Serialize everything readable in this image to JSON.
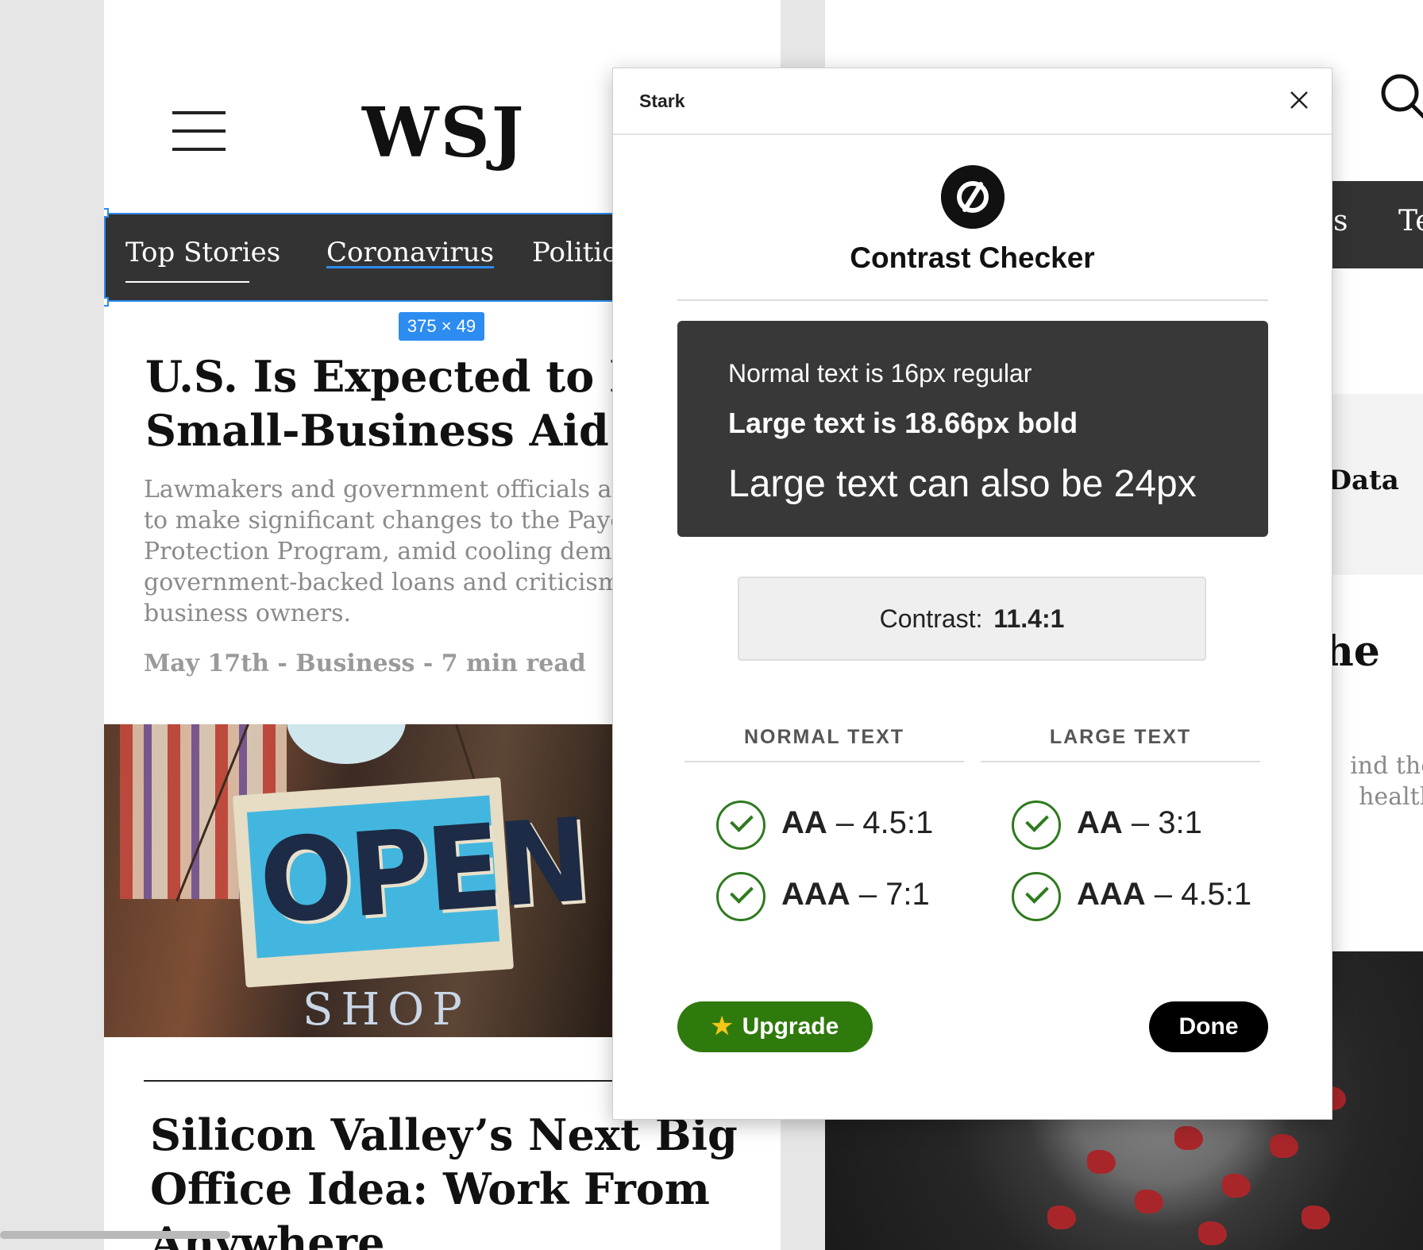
{
  "left_artboard": {
    "logo": "WSJ",
    "nav": {
      "items": [
        "Top Stories",
        "Coronavirus",
        "Politics"
      ],
      "active": "Top Stories"
    },
    "selection_badge": "375 × 49",
    "article1": {
      "headline": "U.S. Is Expected to Revi\nSmall-Business Aid Prog",
      "summary": "Lawmakers and government officials are pr\nto make significant changes to the Paycheck\nProtection Program, amid cooling demand f\ngovernment-backed loans and criticism from\nbusiness owners.",
      "meta": "May 17th - Business - 7 min read"
    },
    "photo": {
      "sign_text": "OPEN",
      "shop_text": "SHOP"
    },
    "article2": {
      "headline": "Silicon Valley’s Next Big\nOffice Idea: Work From\nAnywhere"
    }
  },
  "right_artboard": {
    "nav_partial": [
      "s",
      "Te"
    ],
    "data_heading": "e Data",
    "headline_partial": "he",
    "summary_partial": "ind the\nhealth"
  },
  "stark": {
    "title": "Stark",
    "heading": "Contrast Checker",
    "preview": {
      "normal": "Normal text is 16px regular",
      "large_bold": "Large text is 18.66px bold",
      "large": "Large text can also be 24px"
    },
    "contrast_label": "Contrast:",
    "contrast_value": "11.4:1",
    "columns": {
      "normal": {
        "heading": "NORMAL TEXT",
        "aa_level": "AA",
        "aa_ratio": "4.5:1",
        "aaa_level": "AAA",
        "aaa_ratio": "7:1"
      },
      "large": {
        "heading": "LARGE TEXT",
        "aa_level": "AA",
        "aa_ratio": "3:1",
        "aaa_level": "AAA",
        "aaa_ratio": "4.5:1"
      }
    },
    "separator": " – ",
    "upgrade_label": "Upgrade",
    "done_label": "Done"
  },
  "colors": {
    "accent_selection": "#2d8cf0",
    "pass_green": "#2f7a1f",
    "upgrade_green": "#2f7a0c",
    "nav_dark": "#333333"
  },
  "icons": [
    "hamburger-icon",
    "search-icon",
    "close-icon",
    "stark-logo-icon",
    "checkmark-icon",
    "star-icon"
  ]
}
